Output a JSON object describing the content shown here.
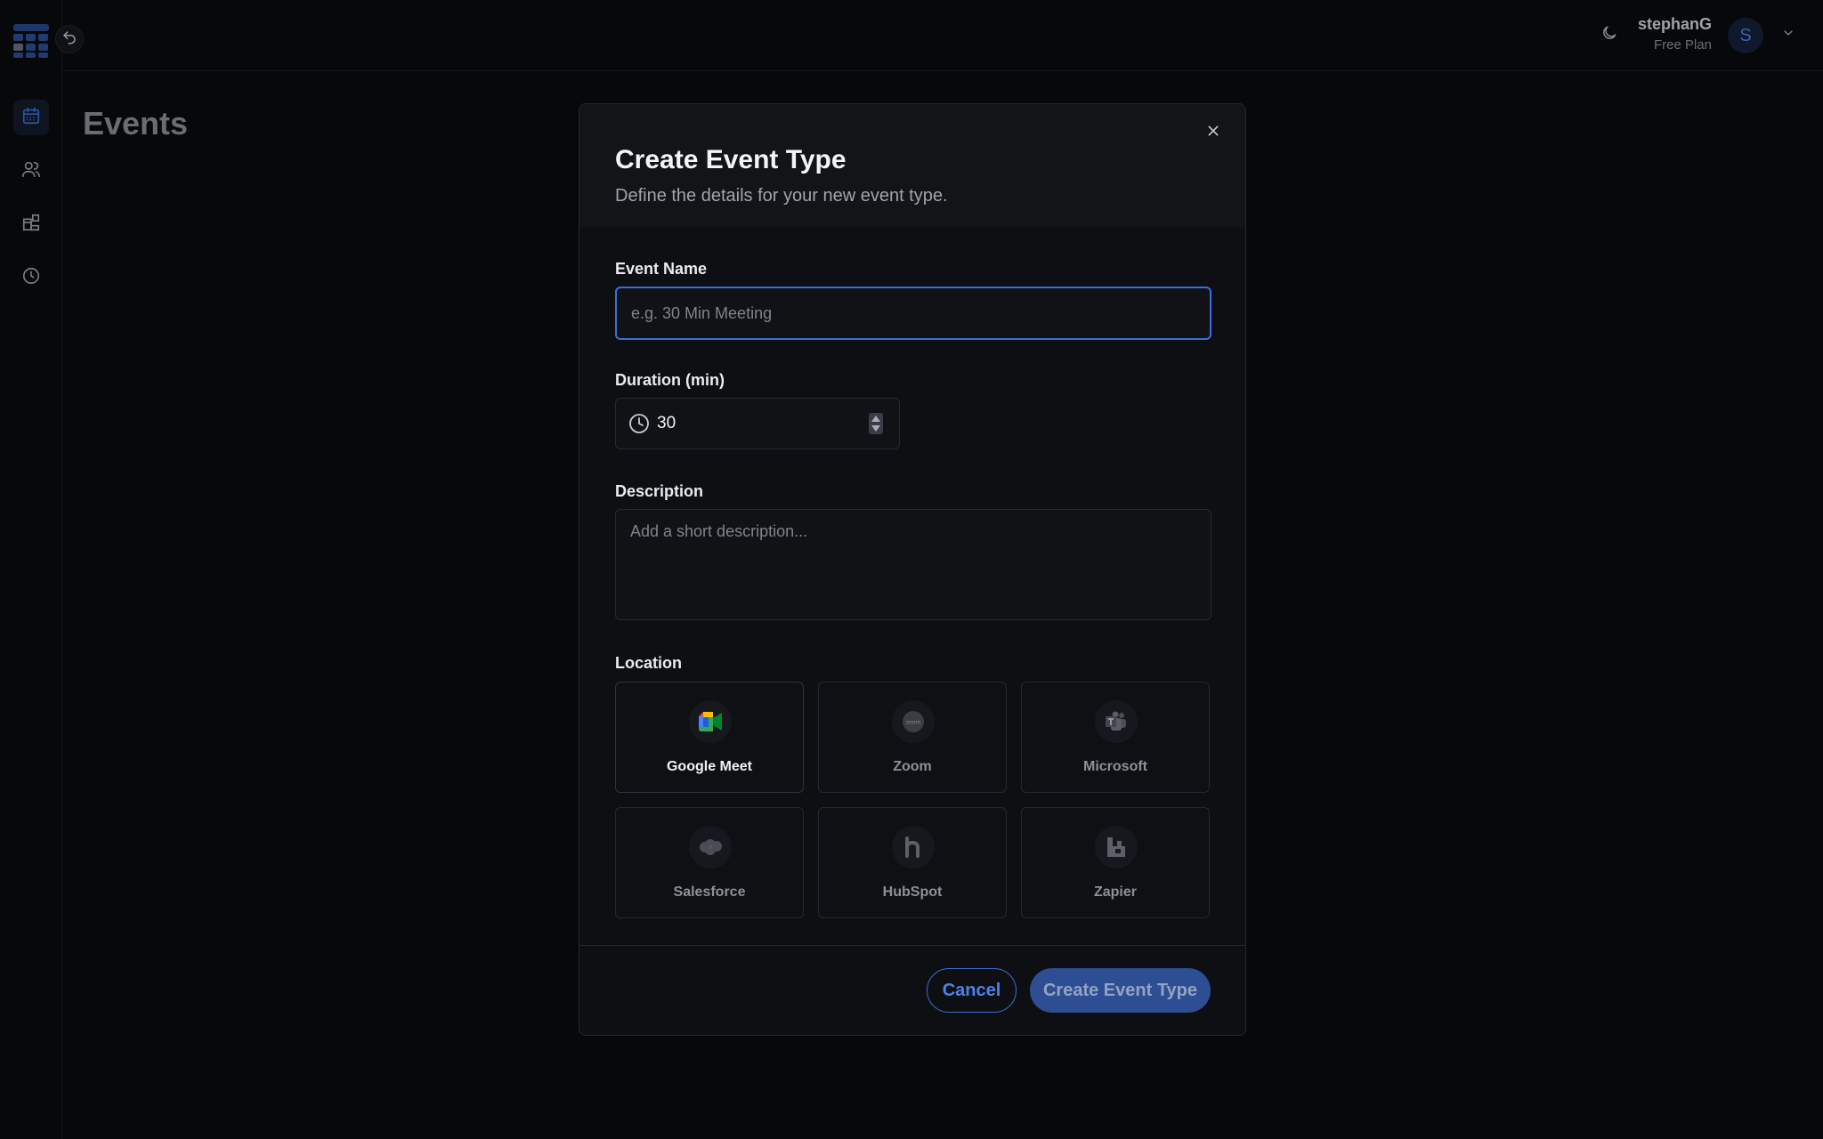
{
  "page": {
    "title": "Events"
  },
  "user": {
    "name": "stephanG",
    "plan": "Free Plan",
    "initial": "S"
  },
  "sidebar": {
    "items": [
      {
        "icon": "calendar-icon",
        "active": true
      },
      {
        "icon": "users-icon",
        "active": false
      },
      {
        "icon": "apps-icon",
        "active": false
      },
      {
        "icon": "clock-icon",
        "active": false
      }
    ]
  },
  "modal": {
    "title": "Create Event Type",
    "subtitle": "Define the details for your new event type.",
    "event_name": {
      "label": "Event Name",
      "value": "",
      "placeholder": "e.g. 30 Min Meeting"
    },
    "duration": {
      "label": "Duration (min)",
      "value": "30"
    },
    "description": {
      "label": "Description",
      "value": "",
      "placeholder": "Add a short description..."
    },
    "location": {
      "label": "Location",
      "options": [
        {
          "name": "Google Meet",
          "icon": "google-meet-icon",
          "selected": true
        },
        {
          "name": "Zoom",
          "icon": "zoom-icon",
          "selected": false
        },
        {
          "name": "Microsoft",
          "icon": "microsoft-teams-icon",
          "selected": false
        },
        {
          "name": "Salesforce",
          "icon": "salesforce-icon",
          "selected": false
        },
        {
          "name": "HubSpot",
          "icon": "hubspot-icon",
          "selected": false
        },
        {
          "name": "Zapier",
          "icon": "zapier-icon",
          "selected": false
        }
      ]
    },
    "cancel_label": "Cancel",
    "create_label": "Create Event Type"
  },
  "colors": {
    "accent": "#3c6ee0",
    "background": "#0a0b0e",
    "modal": "#0e0f12"
  }
}
